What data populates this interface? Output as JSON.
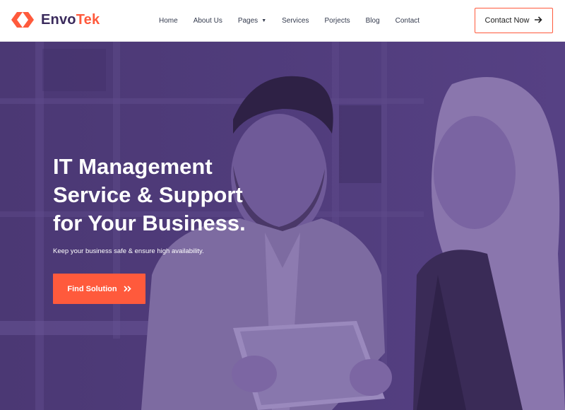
{
  "brand": {
    "name_part1": "Envo",
    "name_part2": "Tek",
    "accent_color": "#ff5a3c",
    "dark_color": "#3a2a5c",
    "icon": "envotek-logo-icon"
  },
  "nav": {
    "items": [
      {
        "label": "Home"
      },
      {
        "label": "About Us"
      },
      {
        "label": "Pages",
        "has_dropdown": true
      },
      {
        "label": "Services"
      },
      {
        "label": "Porjects"
      },
      {
        "label": "Blog"
      },
      {
        "label": "Contact"
      }
    ],
    "contact_button": "Contact Now",
    "contact_icon": "arrow-right-icon"
  },
  "hero": {
    "title_line1": "IT Management",
    "title_line2": "Service & Support",
    "title_line3": "for Your Business.",
    "subtitle": "Keep your business safe & ensure high availability.",
    "cta_label": "Find Solution",
    "cta_icon": "double-chevron-right-icon",
    "overlay_color": "#4e3a78"
  }
}
